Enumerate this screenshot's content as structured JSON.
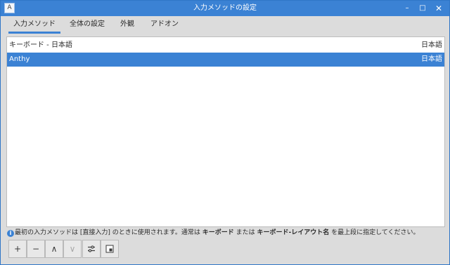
{
  "window": {
    "title": "入力メソッドの設定",
    "app_icon_glyph": "A",
    "minimize_glyph": "–",
    "maximize_glyph": "□",
    "close_glyph": "✕"
  },
  "tabs": [
    {
      "label": "入力メソッド",
      "active": true
    },
    {
      "label": "全体の設定",
      "active": false
    },
    {
      "label": "外観",
      "active": false
    },
    {
      "label": "アドオン",
      "active": false
    }
  ],
  "input_methods": [
    {
      "name": "キーボード - 日本語",
      "language": "日本語",
      "selected": false
    },
    {
      "name": "Anthy",
      "language": "日本語",
      "selected": true
    }
  ],
  "info": {
    "icon": "info-icon",
    "part1": "最初の入力メソッドは [直接入力] のときに使用されます。通常は ",
    "bold1": "キーボード",
    "part2": " または ",
    "bold2": "キーボード-レイアウト名",
    "part3": " を最上段に指定してください。"
  },
  "toolbar": {
    "add_glyph": "+",
    "remove_glyph": "−",
    "up_glyph": "∧",
    "down_glyph": "∨",
    "icons": [
      "plus-icon",
      "minus-icon",
      "arrow-up-icon",
      "arrow-down-icon",
      "configure-icon",
      "keyboard-layout-icon"
    ]
  },
  "colors": {
    "accent": "#3b82d4",
    "selection_text": "#ffffff",
    "window_bg": "#dcdcdc"
  }
}
